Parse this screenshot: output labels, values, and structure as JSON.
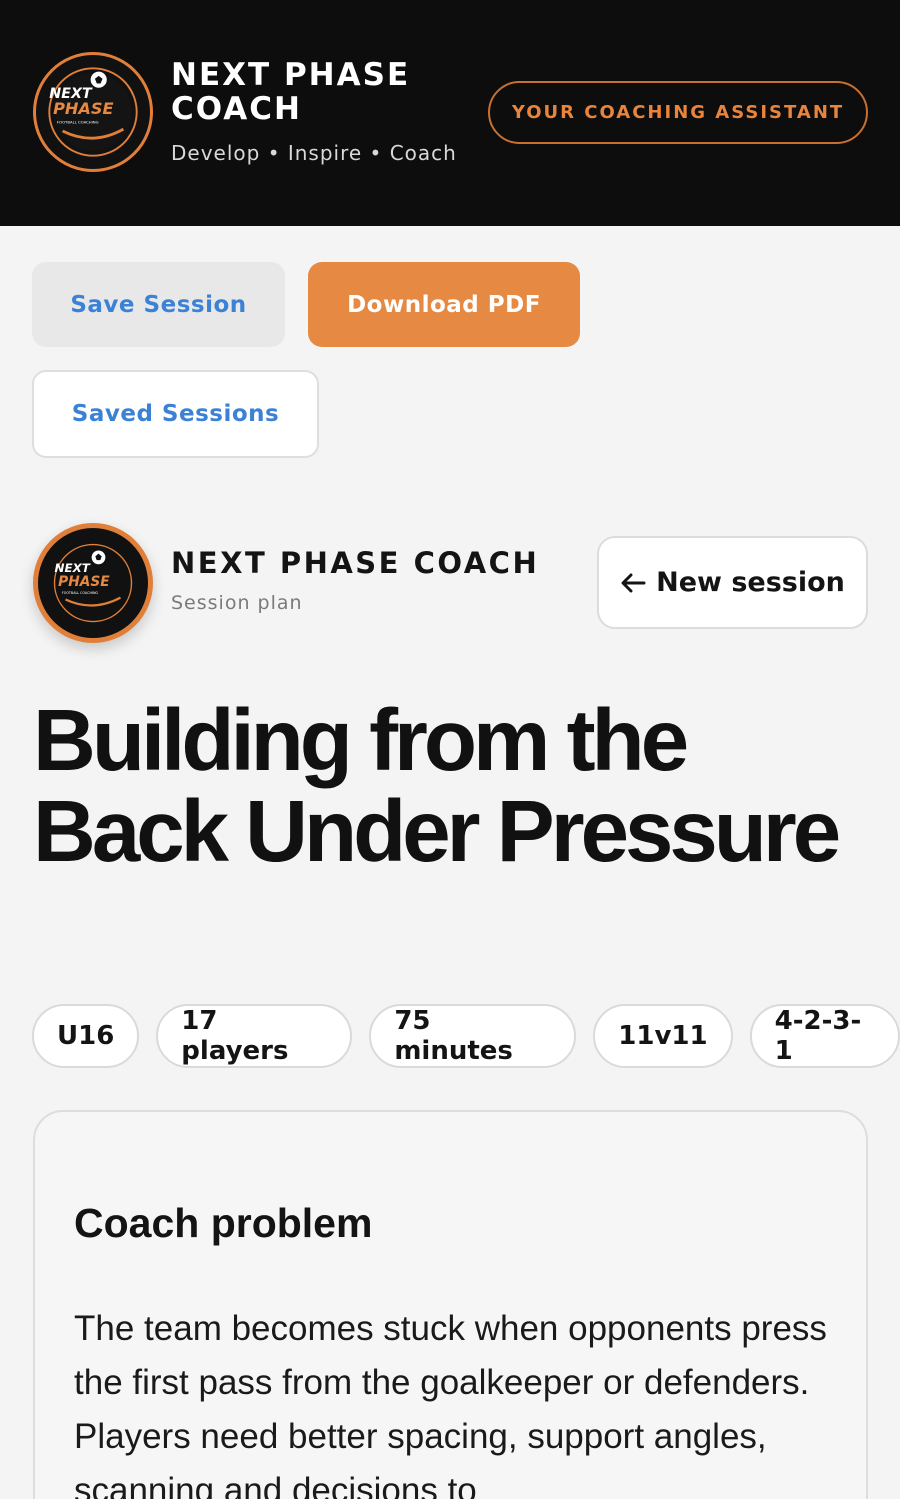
{
  "header": {
    "brand_title": "NEXT PHASE COACH",
    "tagline": "Develop • Inspire • Coach",
    "assistant_label": "YOUR COACHING ASSISTANT",
    "logo": {
      "line1": "NEXT",
      "line2": "PHASE",
      "line3": "FOOTBALL COACHING",
      "icon": "football-logo-icon"
    }
  },
  "actions": {
    "save_label": "Save Session",
    "download_label": "Download PDF",
    "saved_label": "Saved Sessions"
  },
  "session": {
    "brand": "NEXT PHASE COACH",
    "subtitle": "Session plan",
    "new_label": "New session",
    "new_icon": "arrow-left-icon",
    "title": "Building from the Back Under Pressure",
    "tags": [
      "U16",
      "17 players",
      "75 minutes",
      "11v11",
      "4-2-3-1"
    ]
  },
  "card": {
    "title": "Coach problem",
    "body": "The team becomes stuck when opponents press the first pass from the goalkeeper or defenders. Players need better spacing, support angles, scanning and decisions to"
  },
  "colors": {
    "accent": "#e68942",
    "header_bg": "#0d0d0d",
    "link_blue": "#3b82d6",
    "page_bg": "#f4f4f4"
  }
}
